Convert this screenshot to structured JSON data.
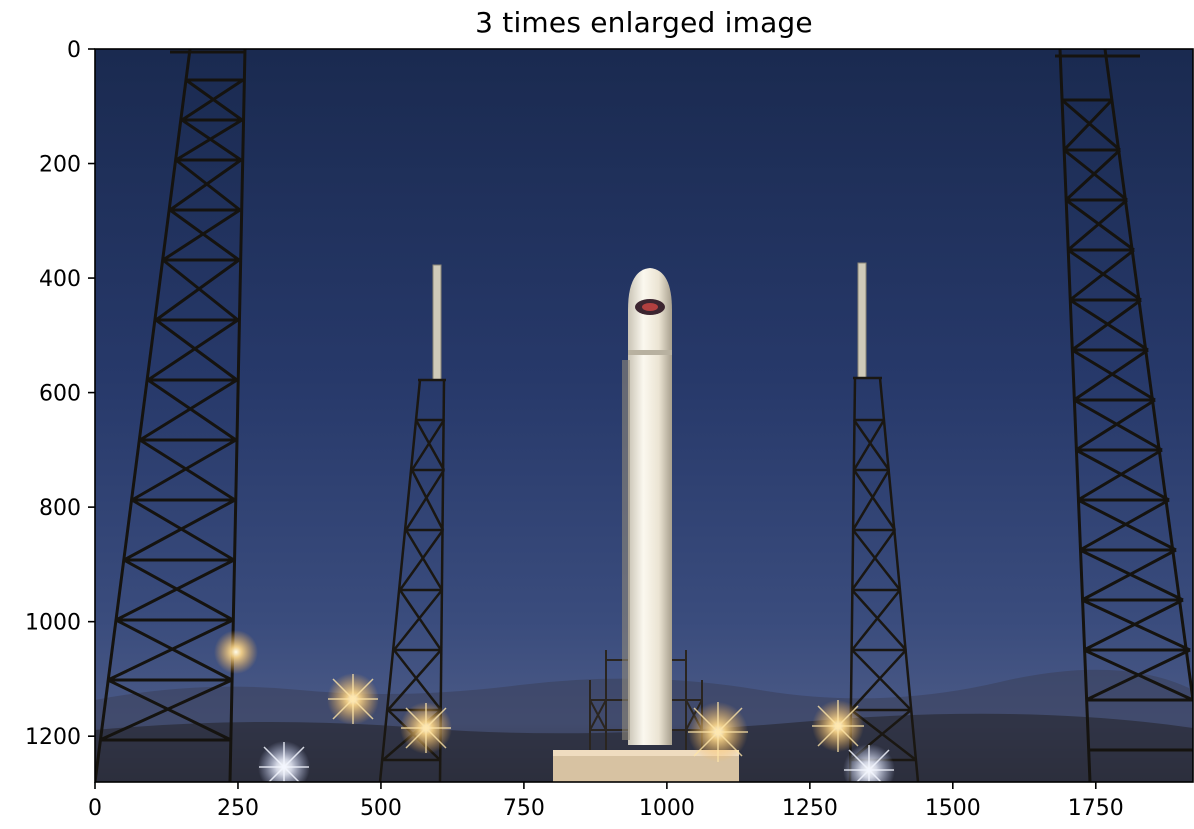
{
  "figure": {
    "title": "3 times enlarged image"
  },
  "image_axes": {
    "x_ticks": [
      0,
      250,
      500,
      750,
      1000,
      1250,
      1500,
      1750
    ],
    "y_ticks": [
      0,
      200,
      400,
      600,
      800,
      1000,
      1200
    ],
    "x_range": [
      0,
      1920
    ],
    "y_range": [
      0,
      1280
    ],
    "y_inverted": true
  },
  "colors": {
    "sky_top": "#1d2c52",
    "sky_mid": "#2a3d6b",
    "sky_horizon": "#5a6a92",
    "tower_stroke": "#1a1712",
    "rocket_body": "#f3efe4",
    "light_glow": "#ffd27a"
  }
}
